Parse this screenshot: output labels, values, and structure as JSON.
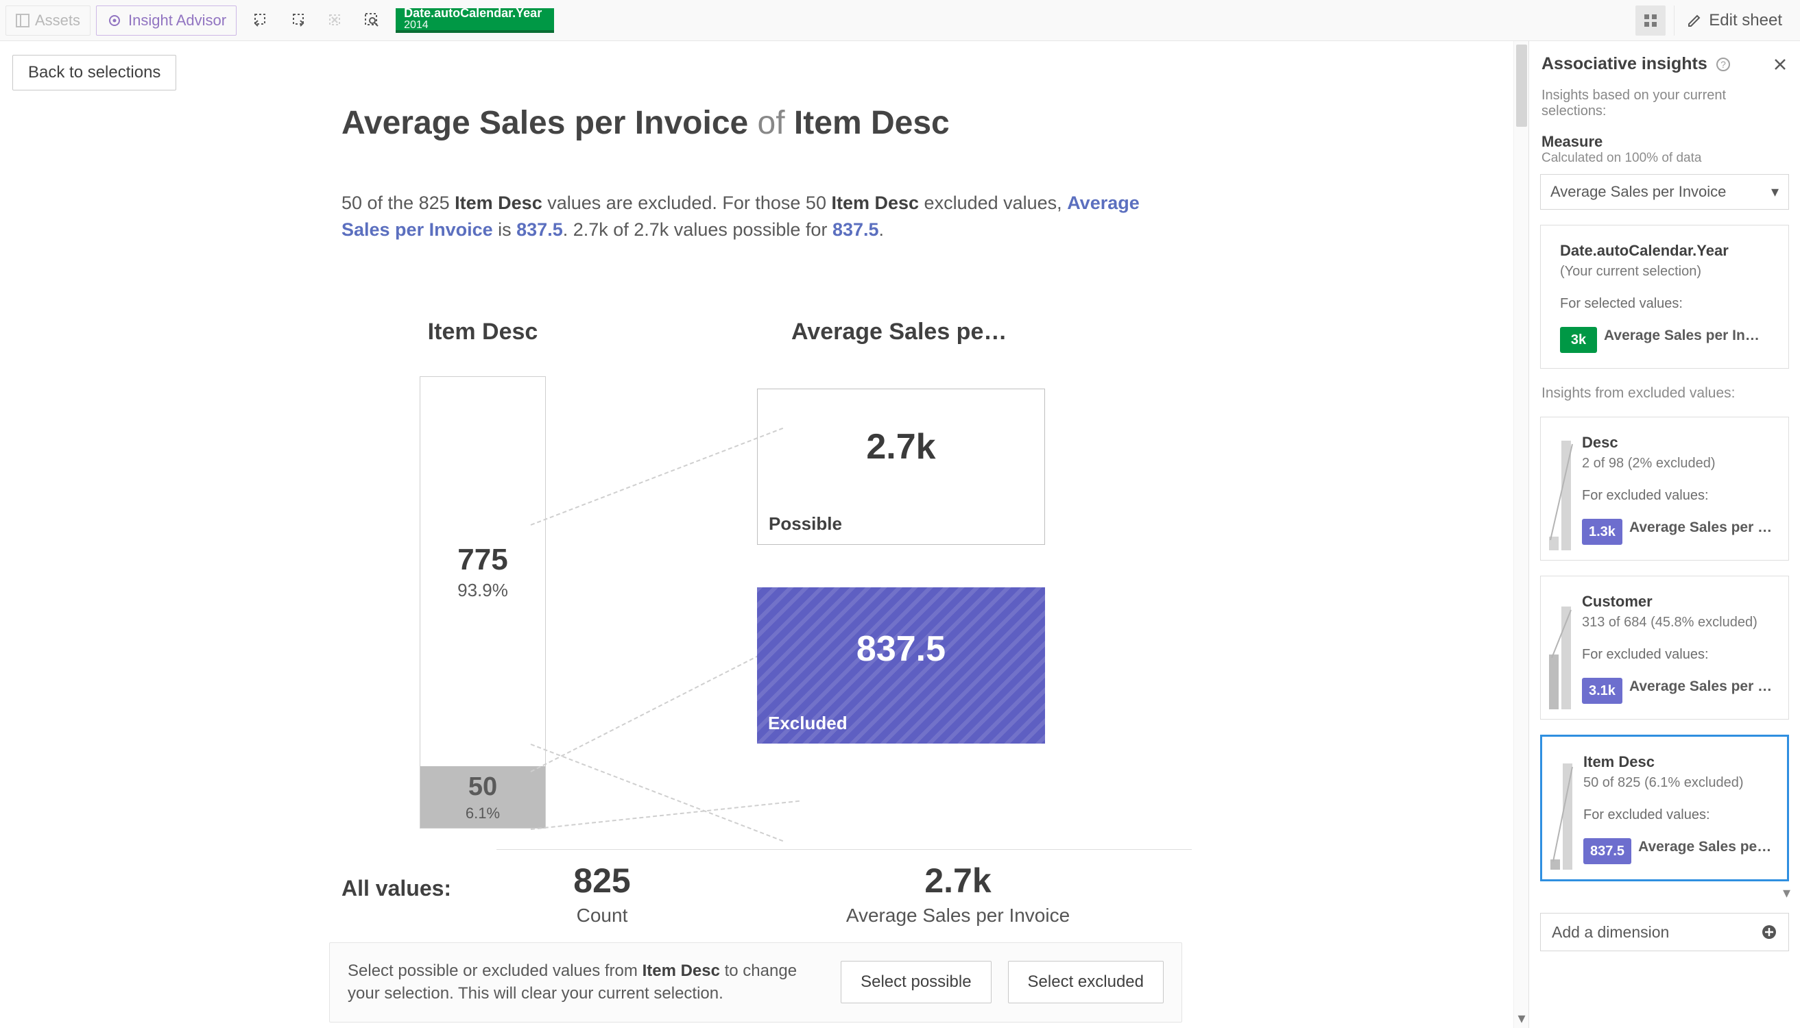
{
  "toolbar": {
    "assets": "Assets",
    "insight_advisor": "Insight Advisor",
    "selection_field": "Date.autoCalendar.Year",
    "selection_value": "2014",
    "edit_sheet": "Edit sheet"
  },
  "page": {
    "back": "Back to selections",
    "title_measure": "Average Sales per Invoice",
    "title_of": "of",
    "title_dim": "Item Desc",
    "desc_p1a": "50 of the 825 ",
    "desc_p1b": "Item Desc",
    "desc_p1c": " values are excluded. For those 50 ",
    "desc_p1d": "Item Desc",
    "desc_p1e": " excluded values, ",
    "desc_link1": "Average Sales per Invoice",
    "desc_p2a": " is ",
    "desc_link2": "837.5",
    "desc_p2b": ". 2.7k of 2.7k values possible for ",
    "desc_link3": "837.5",
    "desc_p2c": "."
  },
  "chart": {
    "left_header": "Item Desc",
    "right_header": "Average Sales per I…",
    "possible_count": "775",
    "possible_pct": "93.9%",
    "excluded_count": "50",
    "excluded_pct": "6.1%",
    "possible_value": "2.7k",
    "possible_label": "Possible",
    "excluded_value": "837.5",
    "excluded_label": "Excluded",
    "all_label": "All values:",
    "all_count": "825",
    "all_count_label": "Count",
    "all_avg": "2.7k",
    "all_avg_label": "Average Sales per Invoice"
  },
  "chart_data": {
    "type": "bar",
    "dimension": "Item Desc",
    "measure": "Average Sales per Invoice",
    "total_count": 825,
    "segments": [
      {
        "name": "Possible",
        "count": 775,
        "percent": 93.9,
        "measure_value": 2700
      },
      {
        "name": "Excluded",
        "count": 50,
        "percent": 6.1,
        "measure_value": 837.5
      }
    ],
    "overall_measure_value": 2700,
    "measure_display": {
      "possible": "2.7k",
      "excluded": "837.5",
      "overall": "2.7k"
    }
  },
  "actionbar": {
    "text_a": "Select possible or excluded values from ",
    "text_b": "Item Desc",
    "text_c": " to change your selection. This will clear your current selection.",
    "btn_possible": "Select possible",
    "btn_excluded": "Select excluded"
  },
  "panel": {
    "title": "Associative insights",
    "based_on": "Insights based on your current selections:",
    "measure_lbl": "Measure",
    "measure_sub": "Calculated on 100% of data",
    "measure_sel": "Average Sales per Invoice",
    "cur_field": "Date.autoCalendar.Year",
    "cur_sub": "(Your current selection)",
    "for_selected": "For selected values:",
    "cur_badge": "3k",
    "cur_metric": "Average Sales per In…",
    "excl_lbl": "Insights from excluded values:",
    "cards": [
      {
        "title": "Desc",
        "sub": "2 of 98 (2% excluded)",
        "for": "For excluded values:",
        "badge": "1.3k",
        "metric": "Average Sales per …"
      },
      {
        "title": "Customer",
        "sub": "313 of 684 (45.8% excluded)",
        "for": "For excluded values:",
        "badge": "3.1k",
        "metric": "Average Sales per …"
      },
      {
        "title": "Item Desc",
        "sub": "50 of 825 (6.1% excluded)",
        "for": "For excluded values:",
        "badge": "837.5",
        "metric": "Average Sales pe…"
      }
    ],
    "add_dim": "Add a dimension"
  }
}
